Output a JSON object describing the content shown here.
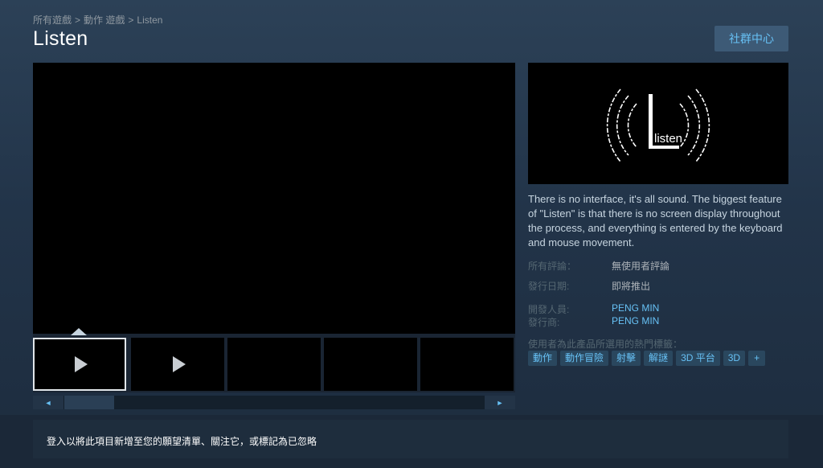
{
  "breadcrumb": {
    "items": [
      "所有遊戲",
      "動作 遊戲",
      "Listen"
    ],
    "separator": ">"
  },
  "title": "Listen",
  "community_button": "社群中心",
  "capsule": {
    "logo_text": "listen"
  },
  "description": "There is no interface, it's all sound. The biggest feature of \"Listen\" is that there is no screen display throughout the process, and everything is entered by the keyboard and mouse movement.",
  "info": {
    "reviews_label": "所有評論：",
    "reviews_value": "無使用者評論",
    "release_label": "發行日期:",
    "release_value": "即將推出",
    "developer_label": "開發人員:",
    "developer_value": "PENG MIN",
    "publisher_label": "發行商:",
    "publisher_value": "PENG MIN",
    "tags_label": "使用者為此產品所選用的熱門標籤："
  },
  "tags": [
    "動作",
    "動作冒險",
    "射擊",
    "解謎",
    "3D 平台",
    "3D",
    "+"
  ],
  "slider": {
    "left_arrow": "◄",
    "right_arrow": "►"
  },
  "bottom_bar": {
    "text": "登入以將此項目新增至您的願望清單、關注它，或標記為已忽略"
  },
  "colors": {
    "accent": "#67c1f5",
    "button_bg": "#3d5a76",
    "tag_bg": "#2a475e"
  }
}
